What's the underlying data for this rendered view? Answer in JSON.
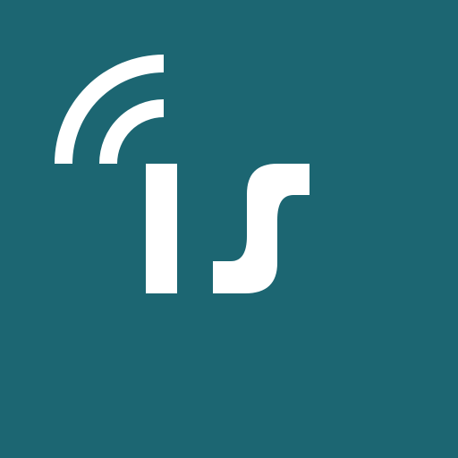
{
  "app_icon": {
    "name": "is-logo",
    "logo_text": "IS",
    "colors": {
      "background": "#1c6672",
      "foreground": "#ffffff"
    }
  }
}
